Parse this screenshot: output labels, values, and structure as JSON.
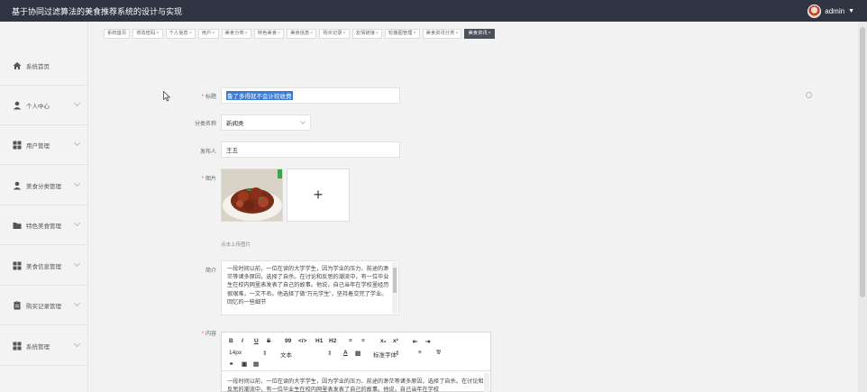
{
  "header": {
    "title": "基于协同过滤算法的美食推荐系统的设计与实现",
    "username": "admin"
  },
  "sidebar": {
    "items": [
      {
        "label": "系统首页",
        "icon": "home-icon"
      },
      {
        "label": "个人中心",
        "icon": "user-icon"
      },
      {
        "label": "用户管理",
        "icon": "grid-icon"
      },
      {
        "label": "美食分类管理",
        "icon": "user-icon"
      },
      {
        "label": "特色美食管理",
        "icon": "folder-icon"
      },
      {
        "label": "美食信息管理",
        "icon": "grid-icon"
      },
      {
        "label": "购买记录管理",
        "icon": "clipboard-icon"
      },
      {
        "label": "系统管理",
        "icon": "grid-icon"
      }
    ]
  },
  "tabs": [
    {
      "label": "系统首页",
      "closable": false
    },
    {
      "label": "修改密码",
      "closable": true
    },
    {
      "label": "个人信息",
      "closable": true
    },
    {
      "label": "用户",
      "closable": true
    },
    {
      "label": "美食分类",
      "closable": true
    },
    {
      "label": "特色美食",
      "closable": true
    },
    {
      "label": "美食信息",
      "closable": true
    },
    {
      "label": "购买记录",
      "closable": true
    },
    {
      "label": "友情链接",
      "closable": true
    },
    {
      "label": "轮播图管理",
      "closable": true
    },
    {
      "label": "美食资讯分类",
      "closable": true
    },
    {
      "label": "美食资讯",
      "closable": true,
      "active": true
    }
  ],
  "form": {
    "title_label": "标题",
    "title_value": "鲁了多得就不会计较收费",
    "category_label": "分类名称",
    "category_value": "新闻类",
    "publisher_label": "发布人",
    "publisher_value": "王五",
    "image_label": "图片",
    "upload_plus": "+",
    "upload_hint": "点击上传图片",
    "intro_label": "简介",
    "intro_text": "一段时间以前，一位在读的大学学生，因为学业的压力、前途的渺茫等诸多原因，选择了自杀。在讨论和反思的潮流中，有一位毕业生在校内网里表发表了自己的故事。他说，自己当年在学校里经历很艰难，一文不名。他选择了做“万元学生”，坚持着交完了学业。回忆的一些细节",
    "content_label": "内容",
    "content_text": "一段时间以前，一位在读的大学学生，因为学业的压力、前途的渺茫等诸多原因，选择了自杀。在讨论和反思的潮流中，有一位毕业生在校内网里表发表了自己的故事。他说，自己当年在学校"
  },
  "editor_toolbar": {
    "row1": [
      "B",
      "I",
      "U",
      "S",
      "99",
      "</>",
      "H1",
      "H2",
      "≡",
      "≡",
      "x₂",
      "x²",
      "⇤",
      "⇥"
    ],
    "font_size": "14px",
    "text_type": "文本",
    "font_name": "标准字体"
  }
}
